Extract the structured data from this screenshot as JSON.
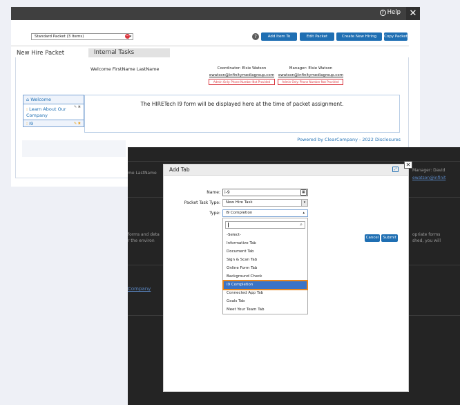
{
  "topbar": {
    "help_label": "Help",
    "help_icon": "question-circle-icon",
    "close_glyph": "✕"
  },
  "packet": {
    "selected": "Standard Packet (3 Items)",
    "buttons": [
      "Add Item To Packet",
      "Edit Packet Details",
      "Create New Hiring Packet",
      "Copy Packet"
    ]
  },
  "tabs": {
    "new_hire": "New Hire Packet",
    "internal": "Internal Tasks"
  },
  "welcome": {
    "name": "Welcome FirstName LastName",
    "coordinator": "Coordinator: Elsie Watson",
    "coordinator_email": "ewatson@infinitymediagroup.com",
    "manager": "Manager: Elsie Watson",
    "manager_email": "ewatson@infinitymediagroup.com",
    "admin_note": "Admin Only: Phone Number Not Provided"
  },
  "sidebar": {
    "items": [
      {
        "label": "Welcome",
        "icon": "house-icon"
      },
      {
        "label": "Learn About Our Company",
        "line1": "Learn About Our",
        "line2": "Company"
      },
      {
        "label": "I9"
      }
    ]
  },
  "main": {
    "i9_message": "The HIRETech I9 form will be displayed here at the time of packet assignment.",
    "powered": "Powered by ClearCompany - 2022 Disclosures"
  },
  "overlay": {
    "fragments": [
      "me LastName",
      "Manager: David",
      "ewatson@infinit",
      "forms and deta",
      "r the environ",
      "opriate forms",
      "shed, you will",
      "Company"
    ]
  },
  "modal": {
    "title": "Add Tab",
    "name_label": "Name:",
    "name_value": "i-9",
    "task_type_label": "Packet Task Type:",
    "task_type_value": "New Hire Task",
    "type_label": "Type:",
    "type_value": "I9 Completion",
    "search_placeholder": "",
    "options": [
      "-Select-",
      "Informative Tab",
      "Document Tab",
      "Sign & Scan Tab",
      "Online Form Tab",
      "Background Check",
      "I9 Completion",
      "Connected App Tab",
      "Goals Tab",
      "Meet Your Team Tab"
    ],
    "highlighted_option": "I9 Completion",
    "cancel": "Cancel",
    "submit": "Submit"
  },
  "colors": {
    "accent": "#1f6fb3",
    "highlight": "#3a73c6",
    "highlight_border": "#e8871e",
    "danger": "#d9363e",
    "dark_bar": "#3f3f3f"
  }
}
